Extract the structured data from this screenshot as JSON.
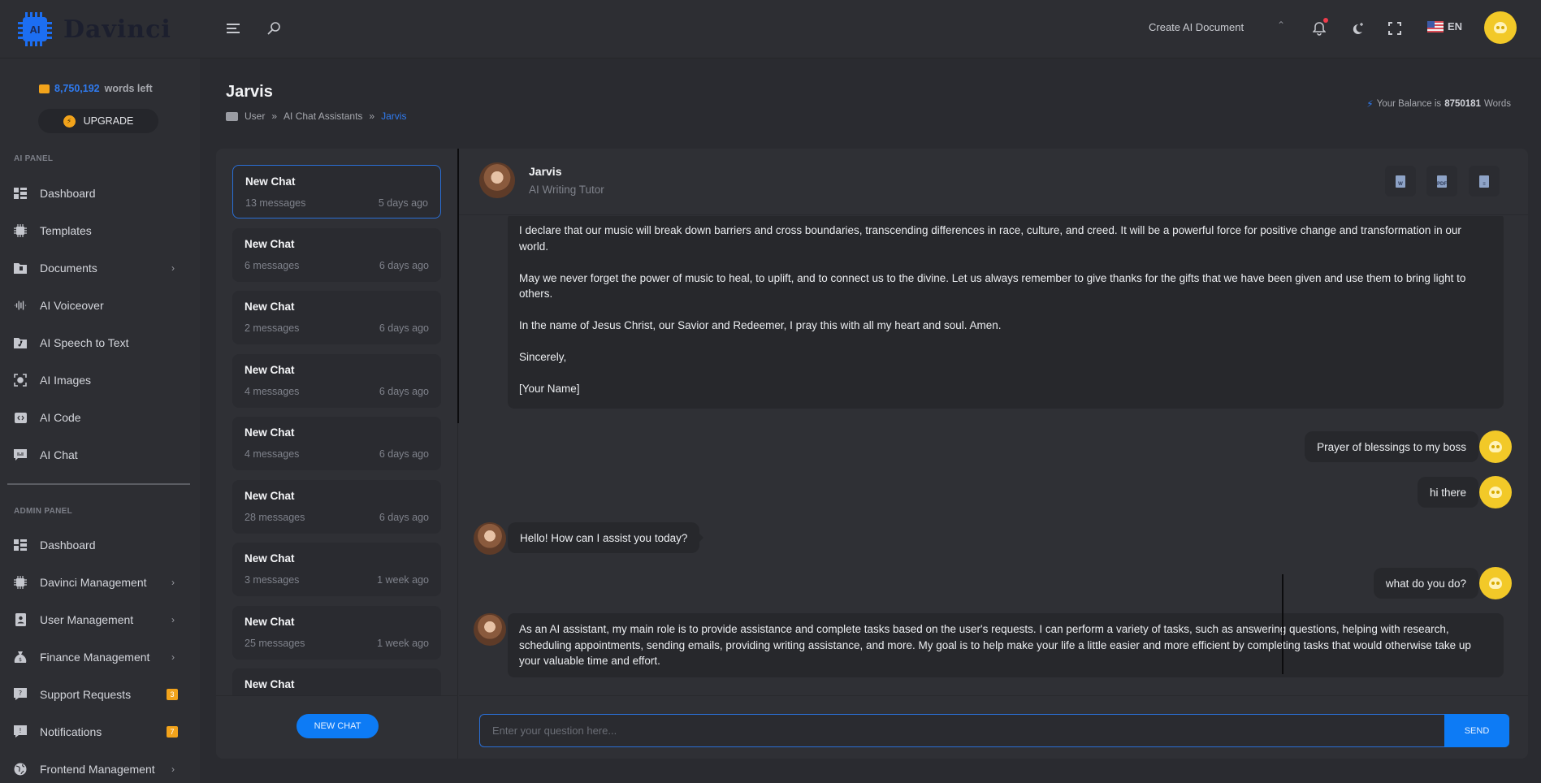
{
  "brand": {
    "logo_chip_text": "AI",
    "logo_text": "Davinci"
  },
  "topbar": {
    "create_doc_label": "Create AI Document",
    "language": "EN",
    "icons": [
      "menu-icon",
      "search-icon",
      "bell-icon",
      "moon-icon",
      "fullscreen-icon",
      "us-flag-icon"
    ]
  },
  "sidebar": {
    "words_left_count": "8,750,192",
    "words_left_label": "words left",
    "upgrade_label": "UPGRADE",
    "ai_panel_label": "AI PANEL",
    "ai_items": [
      {
        "label": "Dashboard",
        "icon": "dashboard-icon"
      },
      {
        "label": "Templates",
        "icon": "ai-chip-icon"
      },
      {
        "label": "Documents",
        "icon": "folder-icon",
        "chevron": true
      },
      {
        "label": "AI Voiceover",
        "icon": "waveform-icon"
      },
      {
        "label": "AI Speech to Text",
        "icon": "music-file-icon"
      },
      {
        "label": "AI Images",
        "icon": "image-scan-icon"
      },
      {
        "label": "AI Code",
        "icon": "code-icon"
      },
      {
        "label": "AI Chat",
        "icon": "chat-icon"
      }
    ],
    "admin_panel_label": "ADMIN PANEL",
    "admin_items": [
      {
        "label": "Dashboard",
        "icon": "dashboard-icon"
      },
      {
        "label": "Davinci Management",
        "icon": "ai-chip-icon",
        "chevron": true
      },
      {
        "label": "User Management",
        "icon": "user-badge-icon",
        "chevron": true
      },
      {
        "label": "Finance Management",
        "icon": "money-bag-icon",
        "chevron": true
      },
      {
        "label": "Support Requests",
        "icon": "question-chat-icon",
        "badge": "3"
      },
      {
        "label": "Notifications",
        "icon": "alert-chat-icon",
        "badge": "7"
      },
      {
        "label": "Frontend Management",
        "icon": "globe-icon",
        "chevron": true
      }
    ]
  },
  "page": {
    "title": "Jarvis",
    "breadcrumb": [
      "User",
      "AI Chat Assistants",
      "Jarvis"
    ],
    "balance_prefix": "Your Balance is",
    "balance_value": "8750181",
    "balance_suffix": "Words"
  },
  "chat_list": {
    "items": [
      {
        "title": "New Chat",
        "messages": "13 messages",
        "date": "5 days ago",
        "active": true
      },
      {
        "title": "New Chat",
        "messages": "6 messages",
        "date": "6 days ago"
      },
      {
        "title": "New Chat",
        "messages": "2 messages",
        "date": "6 days ago"
      },
      {
        "title": "New Chat",
        "messages": "4 messages",
        "date": "6 days ago"
      },
      {
        "title": "New Chat",
        "messages": "4 messages",
        "date": "6 days ago"
      },
      {
        "title": "New Chat",
        "messages": "28 messages",
        "date": "6 days ago"
      },
      {
        "title": "New Chat",
        "messages": "3 messages",
        "date": "1 week ago"
      },
      {
        "title": "New Chat",
        "messages": "25 messages",
        "date": "1 week ago"
      },
      {
        "title": "New Chat",
        "messages": "",
        "date": ""
      }
    ],
    "new_chat_label": "NEW CHAT"
  },
  "chat": {
    "bot_name": "Jarvis",
    "bot_role": "AI Writing Tutor",
    "export_buttons": [
      "word-export-icon",
      "pdf-export-icon",
      "text-export-icon"
    ],
    "export_labels": [
      "W",
      "PDF",
      "≡"
    ],
    "messages": [
      {
        "from": "bot",
        "paragraphs": [
          "I declare that our music will break down barriers and cross boundaries, transcending differences in race, culture, and creed. It will be a powerful force for positive change and transformation in our world.",
          "May we never forget the power of music to heal, to uplift, and to connect us to the divine. Let us always remember to give thanks for the gifts that we have been given and use them to bring light to others.",
          "In the name of Jesus Christ, our Savior and Redeemer, I pray this with all my heart and soul. Amen.",
          "Sincerely,",
          "[Your Name]"
        ]
      },
      {
        "from": "user",
        "text": "Prayer of blessings to my boss"
      },
      {
        "from": "user",
        "text": "hi there"
      },
      {
        "from": "bot",
        "text": "Hello! How can I assist you today?"
      },
      {
        "from": "user",
        "text": "what do you do?"
      },
      {
        "from": "bot",
        "text": "As an AI assistant, my main role is to provide assistance and complete tasks based on the user's requests. I can perform a variety of tasks, such as answering questions, helping with research, scheduling appointments, sending emails, providing writing assistance, and more. My goal is to help make your life a little easier and more efficient by completing tasks that would otherwise take up your valuable time and effort."
      }
    ],
    "input_placeholder": "Enter your question here...",
    "input_value": "",
    "send_label": "SEND"
  },
  "colors": {
    "accent": "#0d7bf5",
    "badge": "#f2a31b",
    "background": "#2a2b30"
  }
}
